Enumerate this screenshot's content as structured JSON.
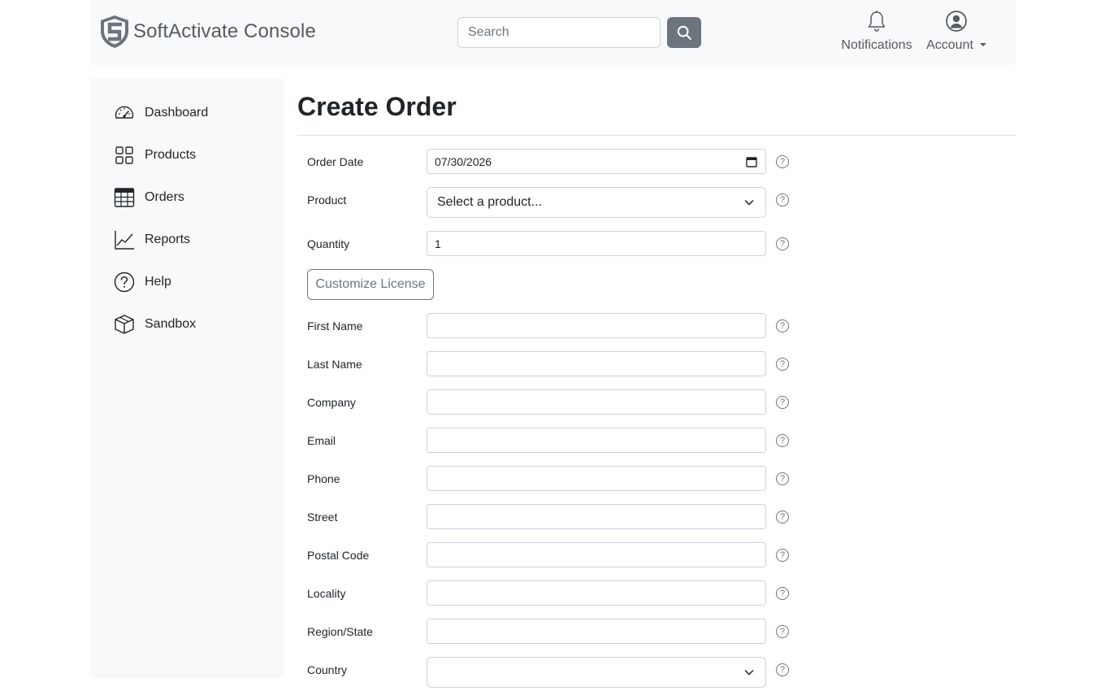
{
  "header": {
    "brand": "SoftActivate Console",
    "search_placeholder": "Search",
    "notifications_label": "Notifications",
    "account_label": "Account"
  },
  "sidebar": {
    "items": [
      {
        "label": "Dashboard",
        "icon": "speedometer-icon"
      },
      {
        "label": "Products",
        "icon": "grid-icon"
      },
      {
        "label": "Orders",
        "icon": "table-icon"
      },
      {
        "label": "Reports",
        "icon": "line-chart-icon"
      },
      {
        "label": "Help",
        "icon": "question-circle-icon"
      },
      {
        "label": "Sandbox",
        "icon": "box-icon"
      }
    ]
  },
  "main": {
    "title": "Create Order",
    "customize_button": "Customize License",
    "fields": {
      "order_date": {
        "label": "Order Date",
        "value": "07/30/2026"
      },
      "product": {
        "label": "Product",
        "value": "Select a product..."
      },
      "quantity": {
        "label": "Quantity",
        "value": "1"
      },
      "first_name": {
        "label": "First Name",
        "value": ""
      },
      "last_name": {
        "label": "Last Name",
        "value": ""
      },
      "company": {
        "label": "Company",
        "value": ""
      },
      "email": {
        "label": "Email",
        "value": ""
      },
      "phone": {
        "label": "Phone",
        "value": ""
      },
      "street": {
        "label": "Street",
        "value": ""
      },
      "postal_code": {
        "label": "Postal Code",
        "value": ""
      },
      "locality": {
        "label": "Locality",
        "value": ""
      },
      "region": {
        "label": "Region/State",
        "value": ""
      },
      "country": {
        "label": "Country",
        "value": ""
      }
    },
    "help_glyph": "?"
  },
  "colors": {
    "navbar_bg": "#f8f9fa",
    "search_button": "#6c757d",
    "border": "#ced4da",
    "muted_text": "#555b61"
  }
}
